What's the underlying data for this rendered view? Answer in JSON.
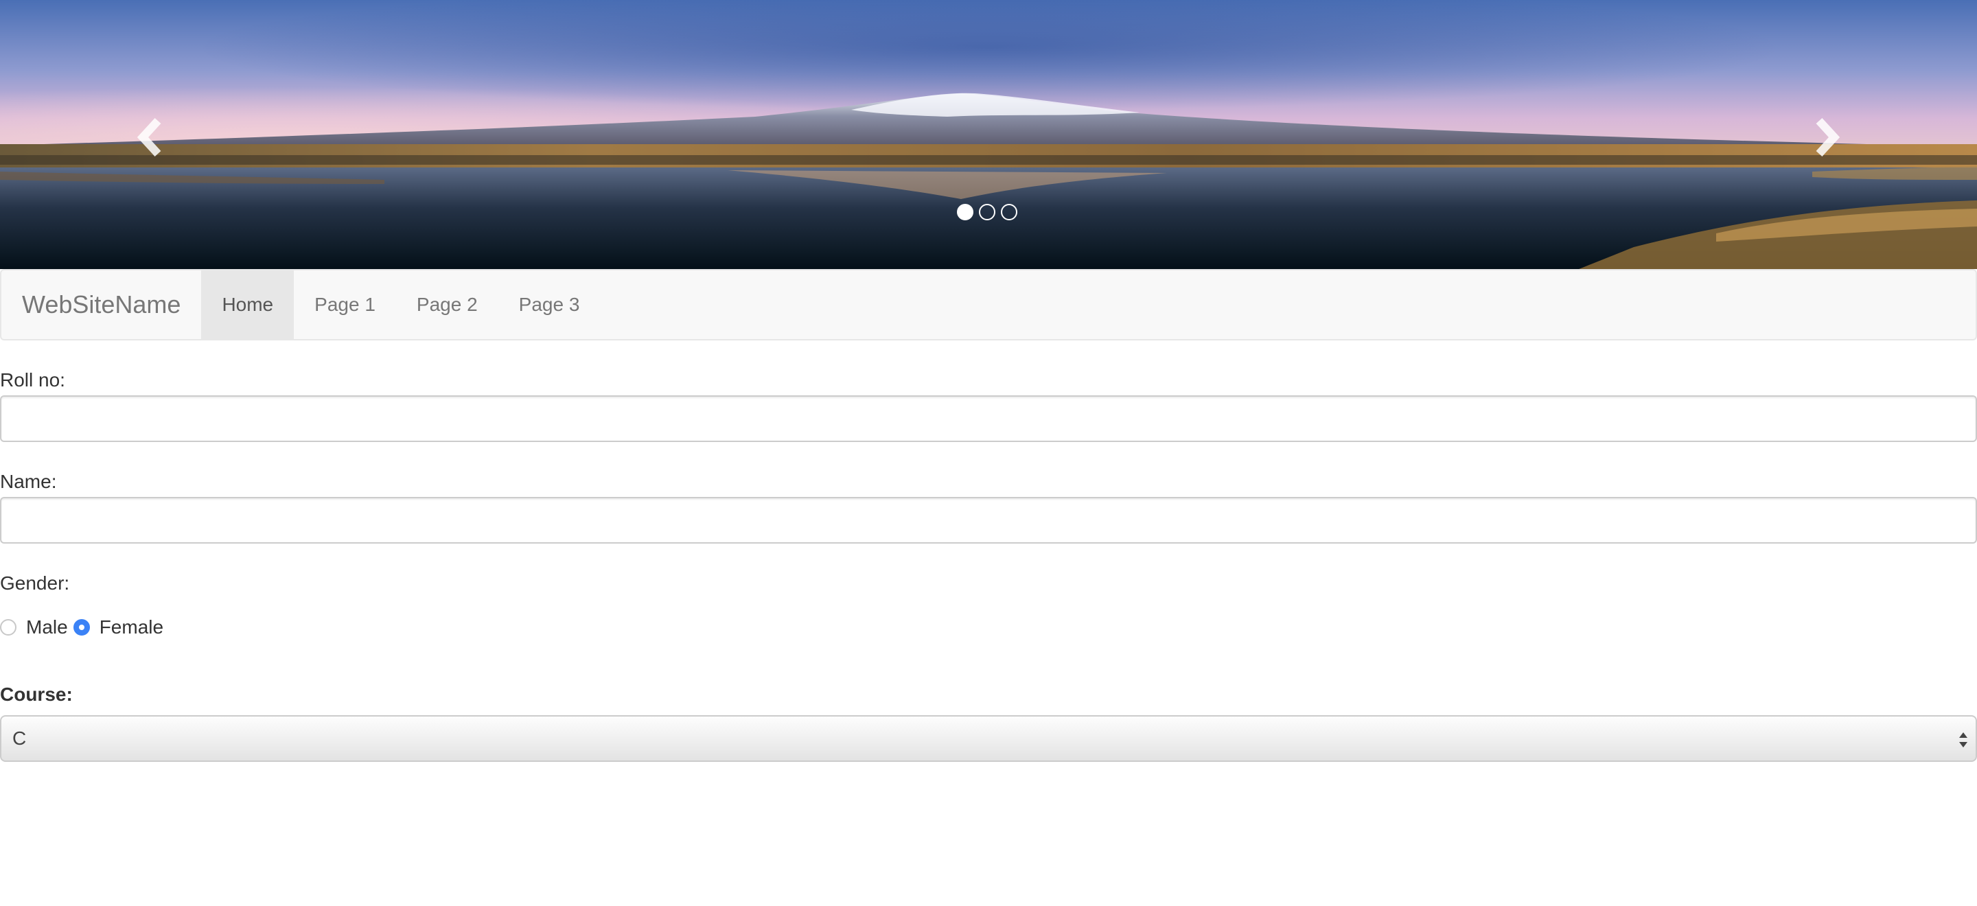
{
  "carousel": {
    "prev_icon": "chevron-left-icon",
    "next_icon": "chevron-right-icon",
    "slide_count": 3,
    "active_slide": 1
  },
  "navbar": {
    "brand": "WebSiteName",
    "items": [
      {
        "label": "Home",
        "active": true
      },
      {
        "label": "Page 1",
        "active": false
      },
      {
        "label": "Page 2",
        "active": false
      },
      {
        "label": "Page 3",
        "active": false
      }
    ]
  },
  "form": {
    "roll_label": "Roll no:",
    "roll_value": "",
    "name_label": "Name:",
    "name_value": "",
    "gender_label": "Gender:",
    "gender_options": [
      {
        "label": "Male",
        "checked": false
      },
      {
        "label": "Female",
        "checked": true
      }
    ],
    "course_label": "Course:",
    "course_value": "C"
  },
  "colors": {
    "navbar_bg": "#f8f8f8",
    "nav_active_bg": "#e7e7e7",
    "radio_checked": "#3b82f6"
  }
}
